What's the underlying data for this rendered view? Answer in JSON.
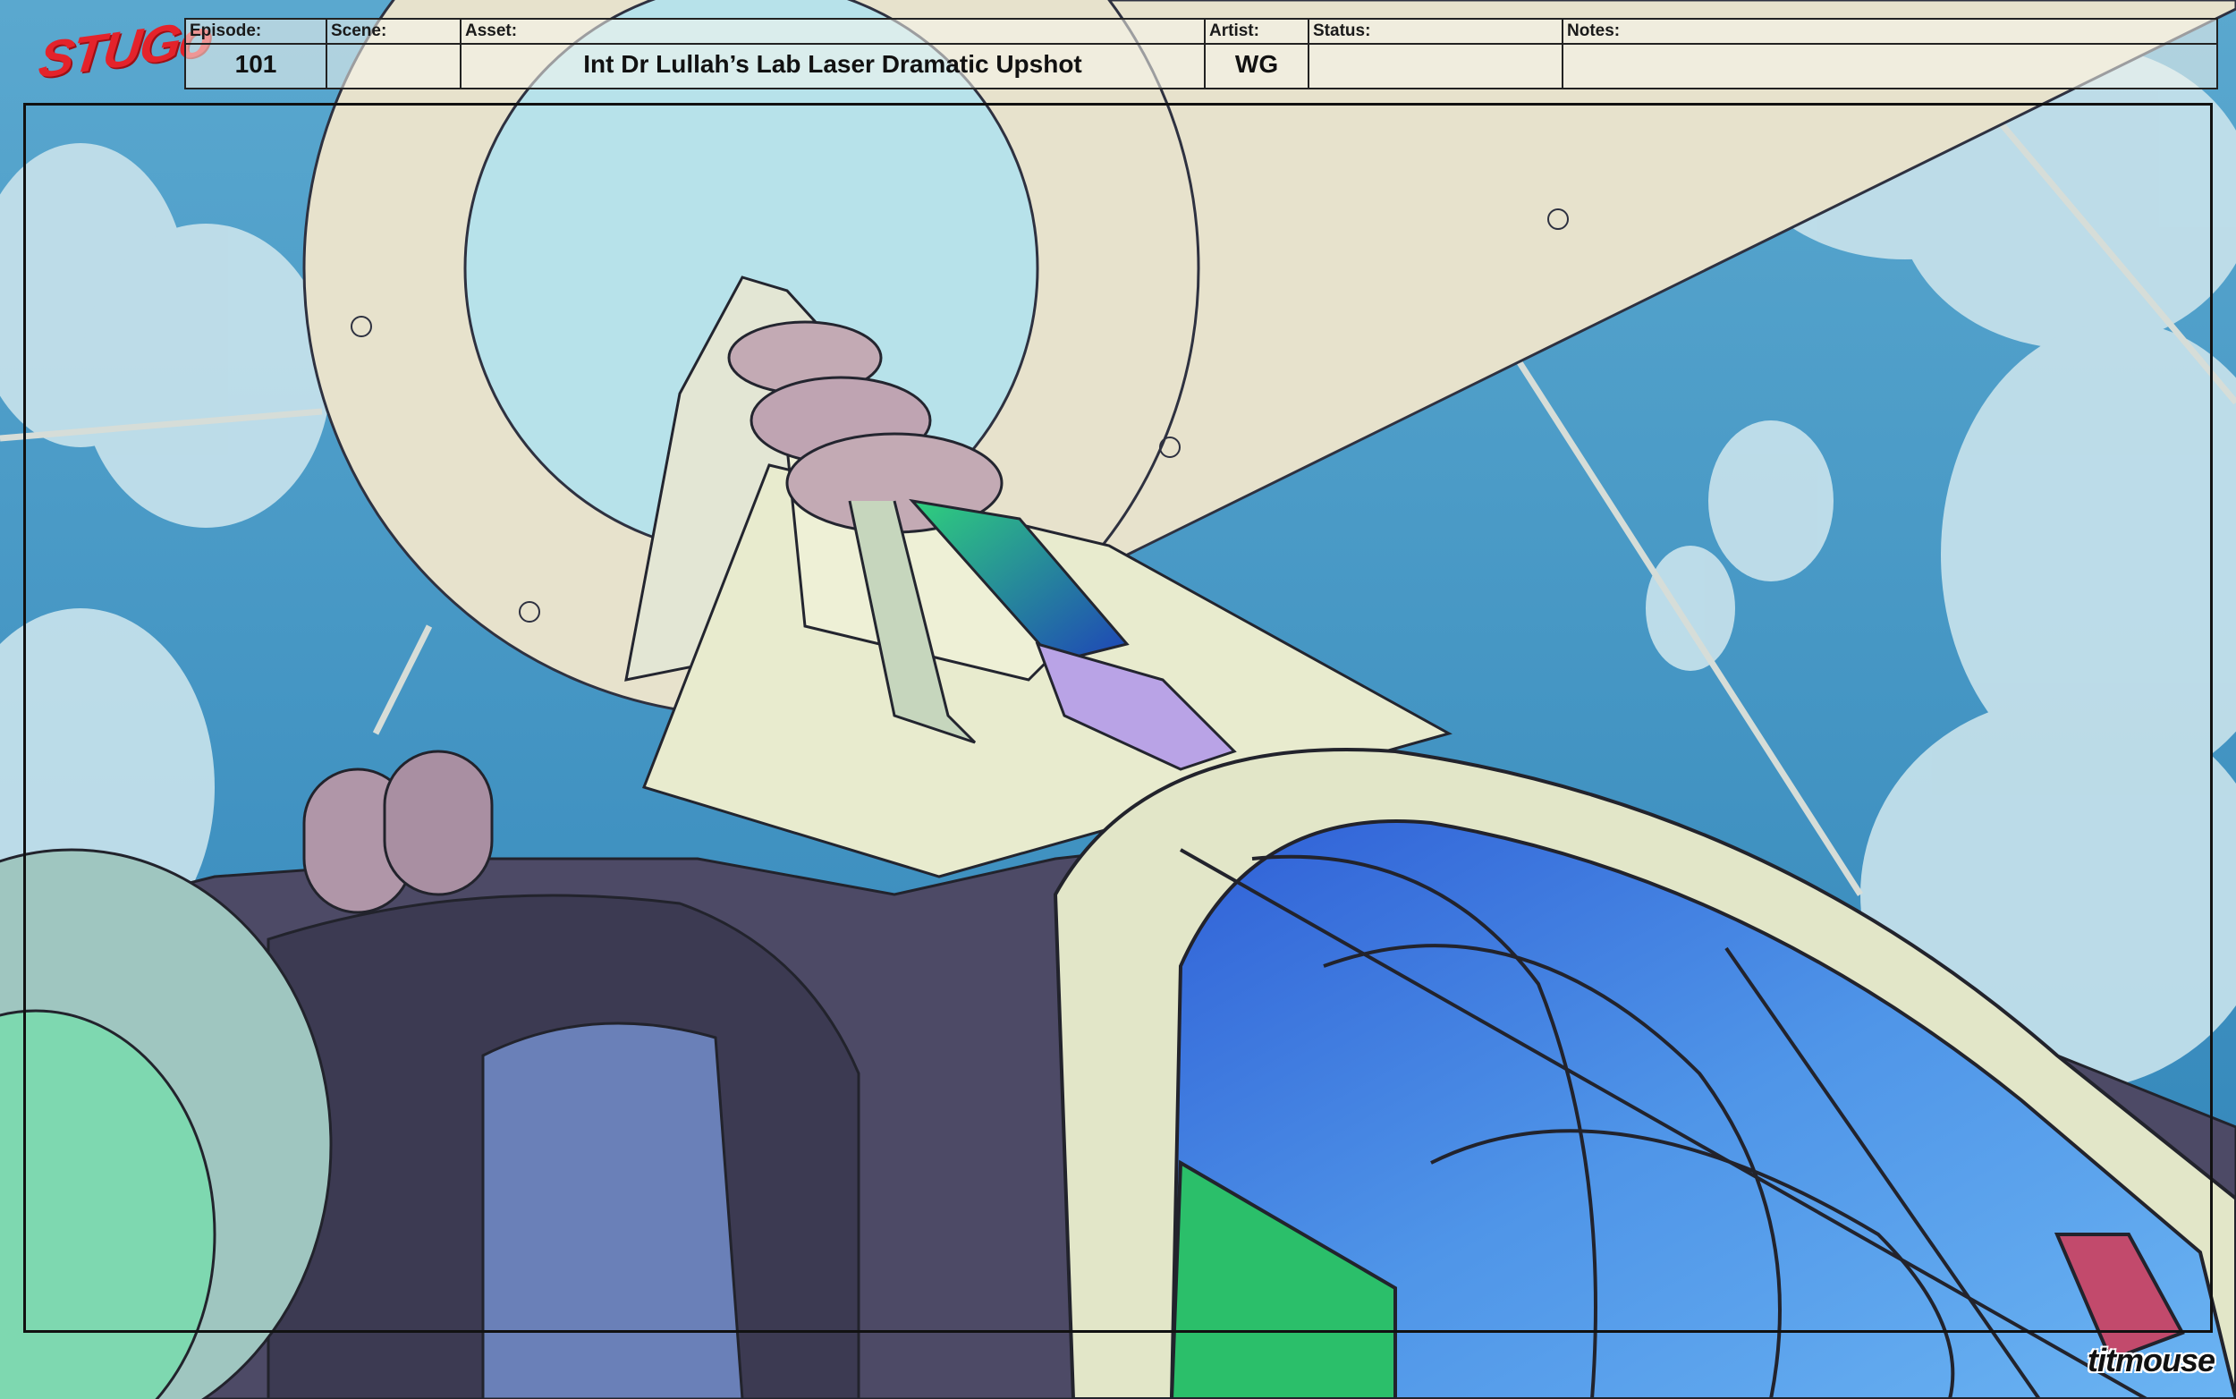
{
  "show_logo": "STUGo",
  "slate": {
    "episode": {
      "label": "Episode:",
      "value": "101"
    },
    "scene": {
      "label": "Scene:",
      "value": ""
    },
    "asset": {
      "label": "Asset:",
      "value": "Int Dr Lullah’s Lab Laser Dramatic Upshot"
    },
    "artist": {
      "label": "Artist:",
      "value": "WG"
    },
    "status": {
      "label": "Status:",
      "value": ""
    },
    "notes": {
      "label": "Notes:",
      "value": ""
    }
  },
  "studio_logo": "titmouse",
  "colors": {
    "sky": "#3f96c4",
    "cloud": "#c9e3ec",
    "tower_cream": "#e8ebce",
    "stone_dark": "#4d4a66",
    "glass_blue": "#3e74d8",
    "glass_green": "#2bbf6a",
    "logo_red": "#e4232b"
  }
}
